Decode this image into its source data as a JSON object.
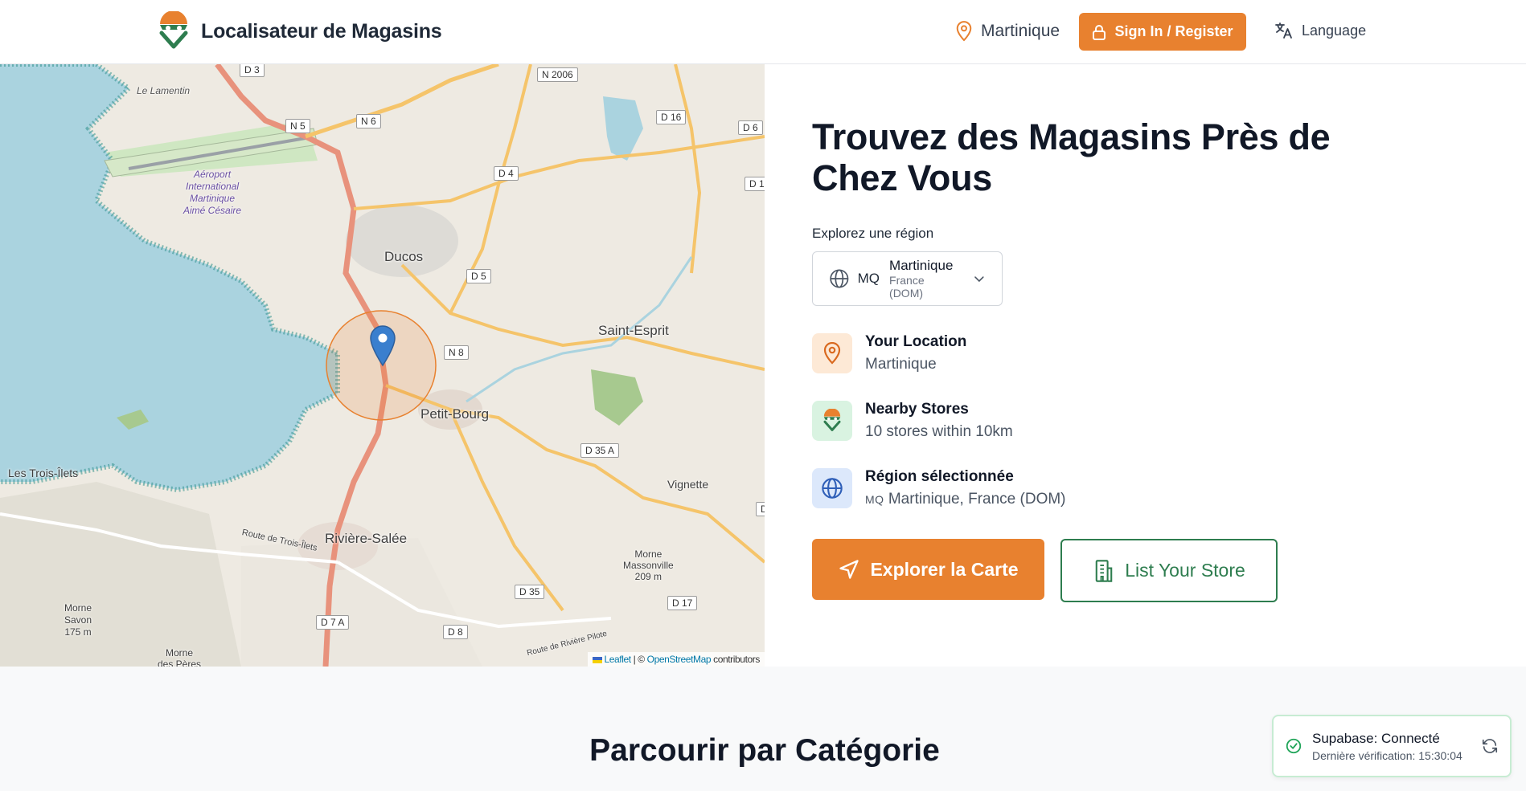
{
  "header": {
    "brand_name": "Localisateur de Magasins",
    "location_label": "Martinique",
    "signin_label": "Sign In / Register",
    "language_label": "Language"
  },
  "map": {
    "labels": {
      "ducos": "Ducos",
      "saint_esprit": "Saint-Esprit",
      "petit_bourg": "Petit-Bourg",
      "trois_ilets": "Les Trois-Îlets",
      "riviere_salee": "Rivière-Salée",
      "vignette": "Vignette",
      "airport_1": "Aéroport",
      "airport_2": "International",
      "airport_3": "Martinique",
      "airport_4": "Aimé Césaire",
      "morne_massonville_1": "Morne",
      "morne_massonville_2": "Massonville",
      "morne_massonville_3": "209 m",
      "morne_savon_1": "Morne",
      "morne_savon_2": "Savon",
      "morne_savon_3": "175 m",
      "morne_peres_1": "Morne",
      "morne_peres_2": "des Pères",
      "route_trois_ilets": "Route de Trois-Îlets",
      "route_riviere_pilote": "Route de Rivière Pilote",
      "lamentin": "Le Lamentin"
    },
    "roads": {
      "d3": "D 3",
      "n2006": "N 2006",
      "n5": "N 5",
      "n6": "N 6",
      "d16": "D 16",
      "d6": "D 6",
      "d4": "D 4",
      "d1": "D 1",
      "d5": "D 5",
      "n8": "N 8",
      "d35a": "D 35 A",
      "d35": "D 35",
      "d17": "D 17",
      "d7a": "D 7 A",
      "d8": "D 8",
      "d_edge": "D"
    },
    "attribution": {
      "leaflet": "Leaflet",
      "sep": "| ©",
      "osm": "OpenStreetMap",
      "contributors": "contributors"
    }
  },
  "hero": {
    "title": "Trouvez des Magasins Près de Chez Vous",
    "explore_label": "Explorez une région",
    "region_select": {
      "code": "MQ",
      "name": "Martinique",
      "subtitle": "France (DOM)"
    }
  },
  "info": {
    "location": {
      "title": "Your Location",
      "value": "Martinique"
    },
    "nearby": {
      "title": "Nearby Stores",
      "value": "10 stores within 10km"
    },
    "region": {
      "title": "Région sélectionnée",
      "code": "MQ",
      "value": "Martinique, France (DOM)"
    }
  },
  "actions": {
    "explore_map": "Explorer la Carte",
    "list_store": "List Your Store"
  },
  "categories": {
    "title": "Parcourir par Catégorie"
  },
  "toast": {
    "title": "Supabase: Connecté",
    "subtitle": "Dernière vérification: 15:30:04"
  },
  "colors": {
    "accent": "#e8812f",
    "brand_green": "#2e7d4f",
    "water": "#aad3df"
  },
  "icons": [
    "logo-icon",
    "map-pin-icon",
    "lock-icon",
    "translate-icon",
    "globe-icon",
    "chevron-down-icon",
    "navigation-icon",
    "building-icon",
    "check-circle-icon",
    "refresh-icon"
  ]
}
